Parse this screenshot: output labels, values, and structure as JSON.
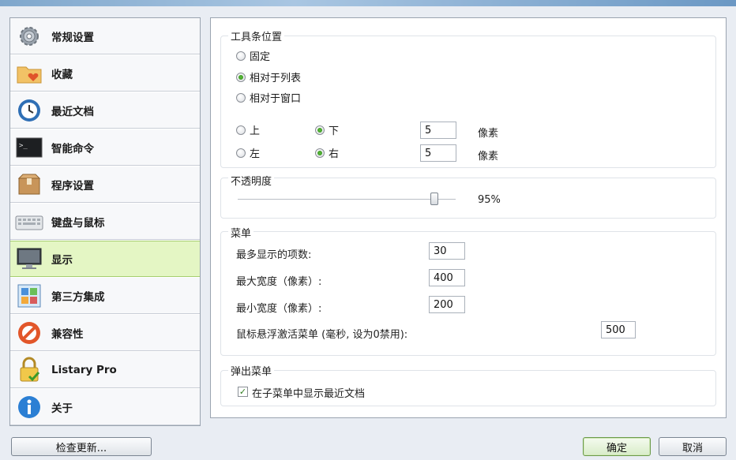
{
  "sidebar": {
    "items": [
      {
        "label": "常规设置",
        "icon": "gear-icon"
      },
      {
        "label": "收藏",
        "icon": "folder-heart-icon"
      },
      {
        "label": "最近文档",
        "icon": "clock-icon"
      },
      {
        "label": "智能命令",
        "icon": "terminal-icon"
      },
      {
        "label": "程序设置",
        "icon": "package-icon"
      },
      {
        "label": "键盘与鼠标",
        "icon": "keyboard-icon"
      },
      {
        "label": "显示",
        "icon": "monitor-icon"
      },
      {
        "label": "第三方集成",
        "icon": "apps-grid-icon"
      },
      {
        "label": "兼容性",
        "icon": "no-entry-icon"
      },
      {
        "label": "Listary Pro",
        "icon": "lock-check-icon"
      },
      {
        "label": "关于",
        "icon": "info-icon"
      }
    ],
    "active_index": 6
  },
  "toolbar_position": {
    "title": "工具条位置",
    "mode_options": [
      "固定",
      "相对于列表",
      "相对于窗口"
    ],
    "selected_mode": "相对于列表",
    "vertical": {
      "option_a": "上",
      "option_b": "下",
      "selected": "下",
      "value": "5",
      "unit": "像素"
    },
    "horizontal": {
      "option_a": "左",
      "option_b": "右",
      "selected": "右",
      "value": "5",
      "unit": "像素"
    }
  },
  "opacity": {
    "title": "不透明度",
    "value_text": "95%",
    "value_fraction": 0.95
  },
  "menu": {
    "title": "菜单",
    "max_items_label": "最多显示的项数:",
    "max_items_value": "30",
    "max_width_label": "最大宽度（像素）:",
    "max_width_value": "400",
    "min_width_label": "最小宽度（像素）:",
    "min_width_value": "200",
    "hover_label": "鼠标悬浮激活菜单 (毫秒, 设为0禁用):",
    "hover_value": "500"
  },
  "popup_menu": {
    "title": "弹出菜单",
    "show_recent_label": "在子菜单中显示最近文档",
    "show_recent_checked": true
  },
  "footer": {
    "check_update": "检查更新...",
    "ok": "确定",
    "cancel": "取消"
  },
  "colors": {
    "active_item_bg": "#e4f6c4",
    "radio_on": "#3a9a28"
  }
}
